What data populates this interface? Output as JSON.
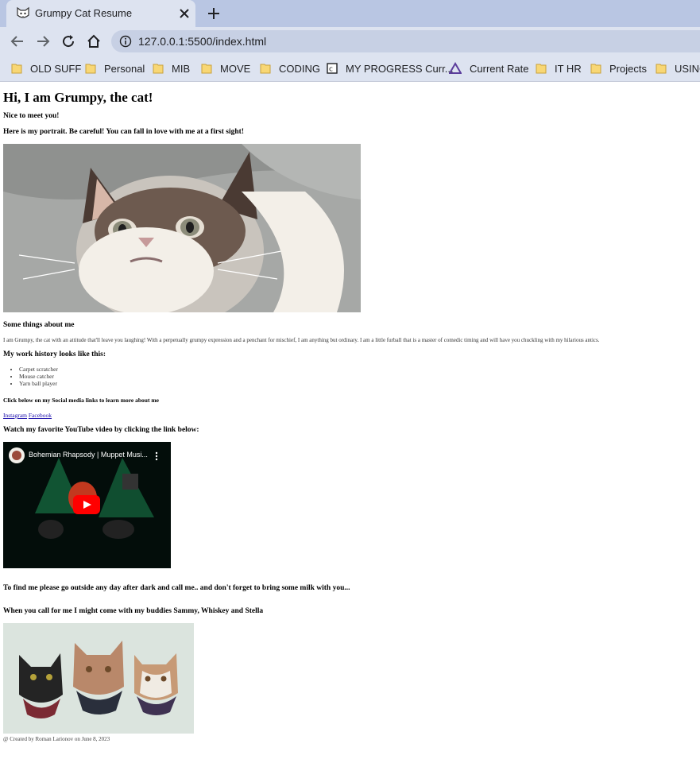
{
  "browser": {
    "tab_title": "Grumpy Cat Resume",
    "url": "127.0.0.1:5500/index.html",
    "bookmarks": [
      {
        "label": "OLD SUFF",
        "icon": "folder-icon"
      },
      {
        "label": "Personal",
        "icon": "folder-icon"
      },
      {
        "label": "MIB",
        "icon": "folder-icon"
      },
      {
        "label": "MOVE",
        "icon": "folder-icon"
      },
      {
        "label": "CODING",
        "icon": "folder-icon"
      },
      {
        "label": "MY PROGRESS Curr...",
        "icon": "codecademy-icon"
      },
      {
        "label": "Current Rate",
        "icon": "triangle-logo-icon"
      },
      {
        "label": "IT HR",
        "icon": "folder-icon"
      },
      {
        "label": "Projects",
        "icon": "folder-icon"
      },
      {
        "label": "USING",
        "icon": "folder-icon"
      }
    ]
  },
  "page": {
    "heading": "Hi, I am Grumpy, the cat!",
    "greeting": "Nice to meet you!",
    "portrait_intro": "Here is my portrait. Be careful! You can fall in love with me at a first sight!",
    "about_heading": "Some things about me",
    "about_text": "I am Grumpy, the cat with an attitude that'll leave you laughing! With a perpetually grumpy expression and a penchant for mischief, I am anything but ordinary. I am a little furball that is a master of comedic timing and will have you chuckling with my hilarious antics.",
    "work_heading": "My work history looks like this:",
    "work_items": [
      "Carpet scratcher",
      "Mouse catcher",
      "Yarn ball player"
    ],
    "social_heading": "Click below on my Social media links to learn more about me",
    "social_links": [
      "Instagram",
      "Facebook"
    ],
    "video_heading": "Watch my favorite YouTube video by clicking the link below:",
    "video_title": "Bohemian Rhapsody | Muppet Musi...",
    "find_me": "To find me please go outside any day after dark and call me.. and don't forget to bring some milk with you...",
    "buddies_text": "When you call for me I might come with my buddies Sammy, Whiskey and Stella",
    "footer": "@ Created by Roman Larionov on June 8, 2023"
  }
}
